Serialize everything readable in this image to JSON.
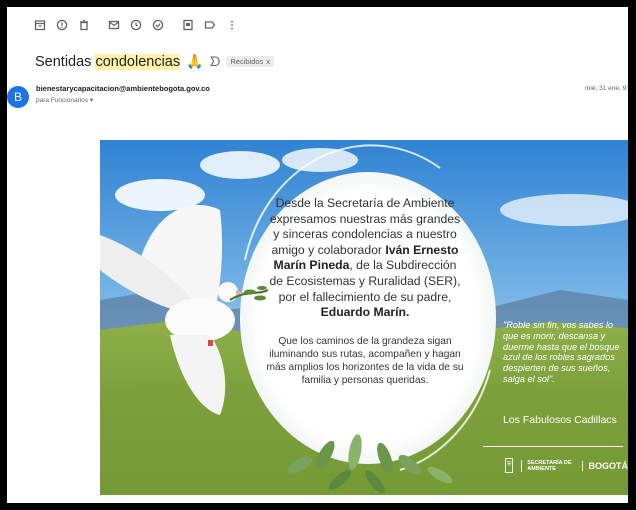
{
  "email": {
    "subject_prefix": "Sentidas ",
    "subject_highlight": "condolencias",
    "subject_emoji": "🙏",
    "label": "Recibidos",
    "label_close": "x",
    "avatar_letter": "B",
    "sender": "bienestarycapacitacion@ambientebogota.gov.co",
    "to": "para Funcionarios ▾",
    "date": "mié, 31 ene, 9:"
  },
  "toolbar": {
    "icons": [
      "archive-icon",
      "report-spam-icon",
      "delete-icon",
      "mark-unread-icon",
      "snooze-icon",
      "add-task-icon",
      "move-to-icon",
      "label-icon",
      "more-icon"
    ]
  },
  "card": {
    "main_line1": "Desde la Secretaría de Ambiente",
    "main_line2": "expresamos nuestras más grandes",
    "main_line3": "y sinceras condolencias a nuestro",
    "main_line4a": "amigo y colaborador ",
    "main_line4b": "Iván Ernesto",
    "main_line5a": "Marín Pineda",
    "main_line5b": ", de la Subdirección",
    "main_line6": "de Ecosistemas y Ruralidad (SER),",
    "main_line7": "por el fallecimiento de su padre,",
    "main_line8": "Eduardo Marín.",
    "sub_line1": "Que los caminos de la grandeza sigan",
    "sub_line2": "iluminando sus rutas, acompañen y hagan",
    "sub_line3": "más amplios los horizontes de la vida de su",
    "sub_line4": "familia y personas queridas.",
    "quote": "\"Roble sin fin, vos sabes lo que es morir, descansa y duerme hasta que el bosque azul de los robles sagrados despierten de sus sueños, salga el sol\".",
    "quote_author": "Los Fabulosos Cadillacs",
    "logo_ambiente": "SECRETARÍA DE AMBIENTE",
    "logo_bogota": "BOGOTÁ"
  }
}
